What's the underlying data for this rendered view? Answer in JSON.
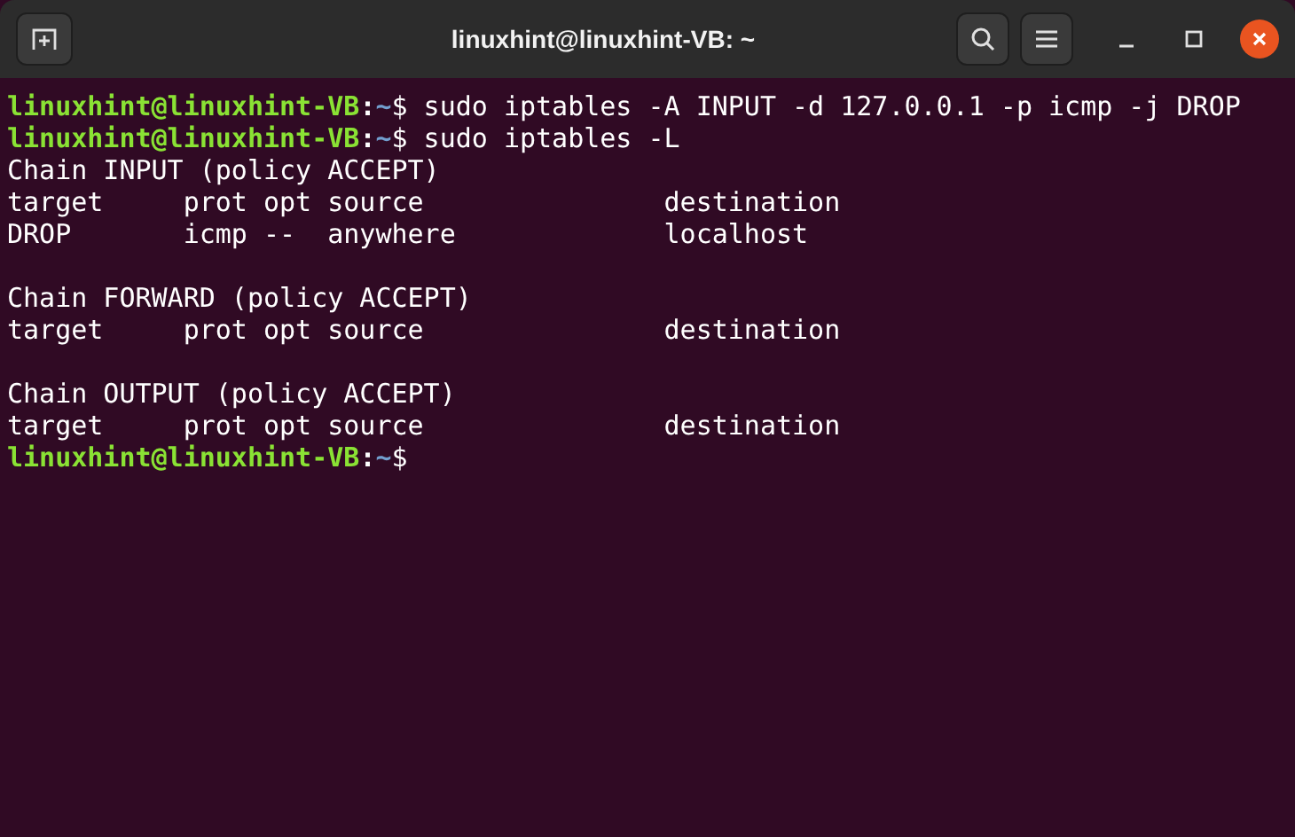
{
  "window": {
    "title": "linuxhint@linuxhint-VB: ~"
  },
  "terminal": {
    "lines": [
      {
        "kind": "prompt",
        "user": "linuxhint@linuxhint-VB",
        "sep": ":",
        "path": "~",
        "symbol": "$",
        "command": " sudo iptables -A INPUT -d 127.0.0.1 -p icmp -j DROP"
      },
      {
        "kind": "prompt",
        "user": "linuxhint@linuxhint-VB",
        "sep": ":",
        "path": "~",
        "symbol": "$",
        "command": " sudo iptables -L"
      },
      {
        "kind": "output",
        "text": "Chain INPUT (policy ACCEPT)"
      },
      {
        "kind": "output",
        "text": "target     prot opt source               destination"
      },
      {
        "kind": "output",
        "text": "DROP       icmp --  anywhere             localhost"
      },
      {
        "kind": "blank"
      },
      {
        "kind": "output",
        "text": "Chain FORWARD (policy ACCEPT)"
      },
      {
        "kind": "output",
        "text": "target     prot opt source               destination"
      },
      {
        "kind": "blank"
      },
      {
        "kind": "output",
        "text": "Chain OUTPUT (policy ACCEPT)"
      },
      {
        "kind": "output",
        "text": "target     prot opt source               destination"
      },
      {
        "kind": "prompt",
        "user": "linuxhint@linuxhint-VB",
        "sep": ":",
        "path": "~",
        "symbol": "$"
      }
    ]
  }
}
